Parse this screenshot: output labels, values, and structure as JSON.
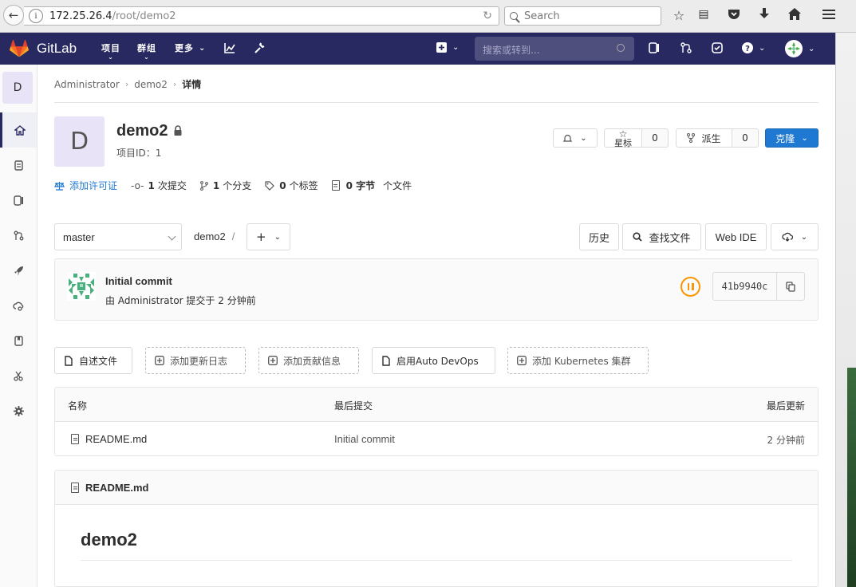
{
  "browser": {
    "url_host": "172.25.26.4",
    "url_path": "/root/demo2",
    "search_placeholder": "Search"
  },
  "navbar": {
    "brand": "GitLab",
    "items": [
      "项目",
      "群组",
      "更多"
    ],
    "search_placeholder": "搜索或转到..."
  },
  "sidebar": {
    "avatar_letter": "D",
    "items": [
      "home-icon",
      "repository-icon",
      "issues-icon",
      "merge-requests-icon",
      "ci-cd-icon",
      "operations-icon",
      "wiki-icon",
      "snippets-icon",
      "settings-icon"
    ]
  },
  "breadcrumb": {
    "items": [
      "Administrator",
      "demo2",
      "详情"
    ]
  },
  "project": {
    "avatar_letter": "D",
    "name": "demo2",
    "id_label": "项目ID：1",
    "star_label": "星标",
    "star_count": "0",
    "fork_label": "派生",
    "fork_count": "0",
    "clone_label": "克隆"
  },
  "stats": {
    "license": "添加许可证",
    "commits_count": "1",
    "commits_label": "次提交",
    "branches_count": "1",
    "branches_label": "个分支",
    "tags_count": "0",
    "tags_label": "个标签",
    "size_count": "0 字节",
    "size_label": "个文件"
  },
  "tree": {
    "branch": "master",
    "path": "demo2",
    "path_sep": "/",
    "history": "历史",
    "find_file": "查找文件",
    "web_ide": "Web IDE"
  },
  "commit": {
    "title": "Initial commit",
    "meta": "由 Administrator 提交于 2 分钟前",
    "sha": "41b9940c"
  },
  "quick_actions": {
    "readme": "自述文件",
    "changelog": "添加更新日志",
    "contributing": "添加贡献信息",
    "autodevops": "启用Auto DevOps",
    "kubernetes": "添加 Kubernetes 集群"
  },
  "files": {
    "headers": [
      "名称",
      "最后提交",
      "最后更新"
    ],
    "rows": [
      {
        "name": "README.md",
        "commit": "Initial commit",
        "updated": "2 分钟前"
      }
    ]
  },
  "readme": {
    "filename": "README.md",
    "heading": "demo2"
  },
  "colors": {
    "navbar": "#292961",
    "primary": "#1f78d1",
    "pipeline_running": "#fc9403"
  }
}
